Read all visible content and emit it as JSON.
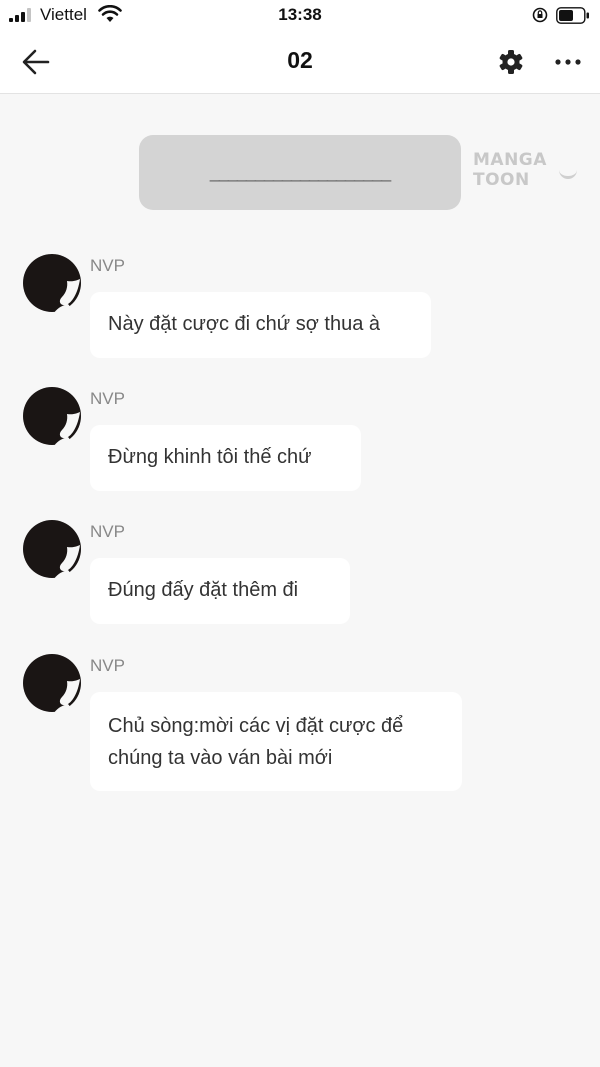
{
  "status_bar": {
    "carrier": "Viettel",
    "time": "13:38"
  },
  "nav": {
    "title": "02"
  },
  "system_message": {
    "text": "____________________"
  },
  "watermark": {
    "text": "MANGA TOON"
  },
  "messages": [
    {
      "sender": "NVP",
      "text": "Này đặt cược đi chứ sợ thua à"
    },
    {
      "sender": "NVP",
      "text": "Đừng khinh tôi thế chứ"
    },
    {
      "sender": "NVP",
      "text": "Đúng đấy đặt thêm đi"
    },
    {
      "sender": "NVP",
      "text": "Chủ sòng:mời các vị đặt cược để chúng ta vào ván bài mới"
    }
  ],
  "icons": {
    "back": "arrow-left-icon",
    "settings": "gear-icon",
    "more": "more-dots-icon",
    "avatar": "silhouette-avatar-icon"
  },
  "colors": {
    "background": "#f7f7f7",
    "bubble": "#ffffff",
    "system_bubble": "#d4d4d4",
    "avatar": "#1a1514"
  }
}
